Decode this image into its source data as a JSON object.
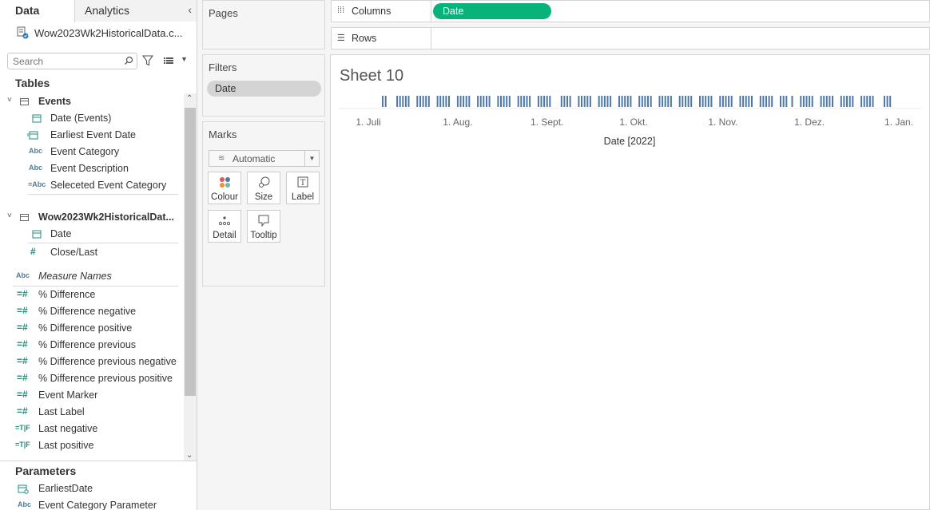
{
  "left_pane": {
    "tab_data": "Data",
    "tab_analytics": "Analytics",
    "data_source": "Wow2023Wk2HistoricalData.c...",
    "search_placeholder": "Search",
    "tables_title": "Tables",
    "parameters_title": "Parameters",
    "fields": [
      {
        "kind": "group",
        "label": "Events"
      },
      {
        "kind": "date",
        "icon": "date-icon",
        "label": "Date (Events)"
      },
      {
        "kind": "calc-date",
        "icon": "calculated-date-icon",
        "label": "Earliest Event Date"
      },
      {
        "kind": "string",
        "icon": "string-icon",
        "label": "Event Category"
      },
      {
        "kind": "string",
        "icon": "string-icon",
        "label": "Event Description"
      },
      {
        "kind": "calc-string",
        "icon": "calculated-string-icon",
        "label": "Seleceted Event Category"
      },
      {
        "kind": "group",
        "label": "Wow2023Wk2HistoricalDat..."
      },
      {
        "kind": "date",
        "icon": "date-icon",
        "label": "Date"
      },
      {
        "kind": "number",
        "icon": "number-icon",
        "label": "Close/Last"
      },
      {
        "kind": "measure-names",
        "icon": "string-icon",
        "label": "Measure Names"
      },
      {
        "kind": "calc-number",
        "icon": "calculated-number-icon",
        "label": "% Difference"
      },
      {
        "kind": "calc-number",
        "icon": "calculated-number-icon",
        "label": "% Difference negative"
      },
      {
        "kind": "calc-number",
        "icon": "calculated-number-icon",
        "label": "% Difference positive"
      },
      {
        "kind": "calc-number",
        "icon": "calculated-number-icon",
        "label": "% Difference previous"
      },
      {
        "kind": "calc-number",
        "icon": "calculated-number-icon",
        "label": "% Difference previous negative"
      },
      {
        "kind": "calc-number",
        "icon": "calculated-number-icon",
        "label": "% Difference previous positive"
      },
      {
        "kind": "calc-number",
        "icon": "calculated-number-icon",
        "label": "Event Marker"
      },
      {
        "kind": "calc-number",
        "icon": "calculated-number-icon",
        "label": "Last Label"
      },
      {
        "kind": "calc-bool",
        "icon": "calculated-boolean-icon",
        "label": "Last negative"
      },
      {
        "kind": "calc-bool",
        "icon": "calculated-boolean-icon",
        "label": "Last positive"
      }
    ],
    "parameters": [
      {
        "icon": "parameter-date-icon",
        "label": "EarliestDate"
      },
      {
        "icon": "parameter-string-icon",
        "label": "Event Category Parameter"
      }
    ]
  },
  "cards": {
    "pages_title": "Pages",
    "filters_title": "Filters",
    "filter_pill": "Date",
    "marks_title": "Marks",
    "mark_type": "Automatic",
    "mark_buttons": [
      "Colour",
      "Size",
      "Label",
      "Detail",
      "Tooltip"
    ]
  },
  "shelves": {
    "columns_label": "Columns",
    "columns_pill": "Date",
    "rows_label": "Rows"
  },
  "view": {
    "sheet_title": "Sheet 10"
  },
  "chart_data": {
    "type": "scatter",
    "mark": "tick",
    "title": "",
    "xlabel": "Date [2022]",
    "x_tick_labels": [
      "1. Juli",
      "1. Aug.",
      "1. Sept.",
      "1. Okt.",
      "1. Nov.",
      "1. Dez.",
      "1. Jan."
    ],
    "x_tick_dates": [
      "2022-07-01",
      "2022-08-01",
      "2022-09-01",
      "2022-10-01",
      "2022-11-01",
      "2022-12-01",
      "2023-01-01"
    ],
    "xlim": [
      "2022-06-25",
      "2023-01-10"
    ],
    "marks_color": "#4e79a7",
    "x": [
      "2022-07-06",
      "2022-07-07",
      "2022-07-11",
      "2022-07-12",
      "2022-07-13",
      "2022-07-14",
      "2022-07-15",
      "2022-07-18",
      "2022-07-19",
      "2022-07-20",
      "2022-07-21",
      "2022-07-22",
      "2022-07-25",
      "2022-07-26",
      "2022-07-27",
      "2022-07-28",
      "2022-07-29",
      "2022-08-01",
      "2022-08-02",
      "2022-08-03",
      "2022-08-04",
      "2022-08-05",
      "2022-08-08",
      "2022-08-09",
      "2022-08-10",
      "2022-08-11",
      "2022-08-12",
      "2022-08-15",
      "2022-08-16",
      "2022-08-17",
      "2022-08-18",
      "2022-08-19",
      "2022-08-22",
      "2022-08-23",
      "2022-08-24",
      "2022-08-25",
      "2022-08-26",
      "2022-08-29",
      "2022-08-30",
      "2022-08-31",
      "2022-09-01",
      "2022-09-02",
      "2022-09-06",
      "2022-09-07",
      "2022-09-08",
      "2022-09-09",
      "2022-09-12",
      "2022-09-13",
      "2022-09-14",
      "2022-09-15",
      "2022-09-16",
      "2022-09-19",
      "2022-09-20",
      "2022-09-21",
      "2022-09-22",
      "2022-09-23",
      "2022-09-26",
      "2022-09-27",
      "2022-09-28",
      "2022-09-29",
      "2022-09-30",
      "2022-10-03",
      "2022-10-04",
      "2022-10-05",
      "2022-10-06",
      "2022-10-07",
      "2022-10-10",
      "2022-10-11",
      "2022-10-12",
      "2022-10-13",
      "2022-10-14",
      "2022-10-17",
      "2022-10-18",
      "2022-10-19",
      "2022-10-20",
      "2022-10-21",
      "2022-10-24",
      "2022-10-25",
      "2022-10-26",
      "2022-10-27",
      "2022-10-28",
      "2022-10-31",
      "2022-11-01",
      "2022-11-02",
      "2022-11-03",
      "2022-11-04",
      "2022-11-07",
      "2022-11-08",
      "2022-11-09",
      "2022-11-10",
      "2022-11-11",
      "2022-11-14",
      "2022-11-15",
      "2022-11-16",
      "2022-11-17",
      "2022-11-18",
      "2022-11-21",
      "2022-11-22",
      "2022-11-23",
      "2022-11-25",
      "2022-11-28",
      "2022-11-29",
      "2022-11-30",
      "2022-12-01",
      "2022-12-02",
      "2022-12-05",
      "2022-12-06",
      "2022-12-07",
      "2022-12-08",
      "2022-12-09",
      "2022-12-12",
      "2022-12-13",
      "2022-12-14",
      "2022-12-15",
      "2022-12-16",
      "2022-12-19",
      "2022-12-20",
      "2022-12-21",
      "2022-12-22",
      "2022-12-23",
      "2022-12-27",
      "2022-12-28",
      "2022-12-29"
    ]
  }
}
